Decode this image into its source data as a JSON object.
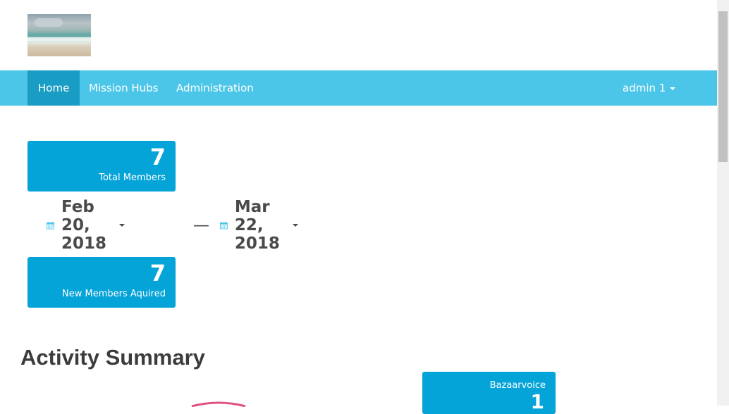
{
  "nav": {
    "items": [
      {
        "label": "Home",
        "active": true
      },
      {
        "label": "Mission Hubs",
        "active": false
      },
      {
        "label": "Administration",
        "active": false
      }
    ],
    "user_label": "admin 1"
  },
  "stats": {
    "total_members": {
      "value": "7",
      "label": "Total Members"
    },
    "new_members": {
      "value": "7",
      "label": "New Members Aquired"
    }
  },
  "date_range": {
    "start": "Feb 20, 2018",
    "separator": "—",
    "end": "Mar 22, 2018"
  },
  "activity": {
    "title": "Activity Summary",
    "source": {
      "label": "Bazaarvoice",
      "value": "1"
    }
  },
  "colors": {
    "navbar": "#4cc6e8",
    "nav_active": "#1a9dc5",
    "stat_box": "#05a4d8",
    "calendar_icon": "#4cc6e8",
    "donut_accent": "#e0527e"
  }
}
